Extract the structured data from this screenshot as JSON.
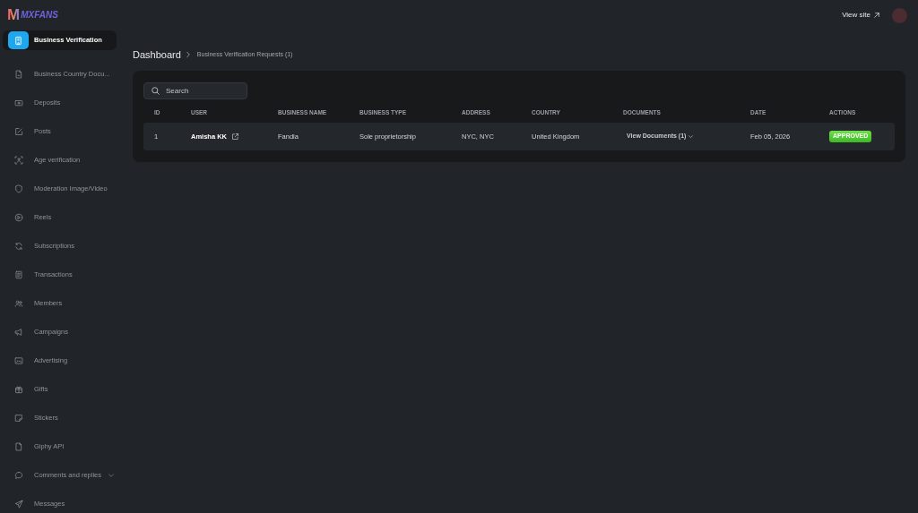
{
  "logo": {
    "mark": "M",
    "name": "MXFANS"
  },
  "sidebar": {
    "items": [
      {
        "label": "Business Verification",
        "kind": "link",
        "selected": true
      },
      {
        "label": "Business Country Docu...",
        "kind": "link",
        "selected": false
      },
      {
        "label": "Deposits",
        "kind": "link",
        "selected": false
      },
      {
        "label": "Posts",
        "kind": "link",
        "selected": false
      },
      {
        "label": "Age verification",
        "kind": "link",
        "selected": false
      },
      {
        "label": "Moderation Image/Video",
        "kind": "link",
        "selected": false
      },
      {
        "label": "Reels",
        "kind": "link",
        "selected": false
      },
      {
        "label": "Subscriptions",
        "kind": "link",
        "selected": false
      },
      {
        "label": "Transactions",
        "kind": "link",
        "selected": false
      },
      {
        "label": "Members",
        "kind": "link",
        "selected": false
      },
      {
        "label": "Campaigns",
        "kind": "link",
        "selected": false
      },
      {
        "label": "Advertising",
        "kind": "link",
        "selected": false
      },
      {
        "label": "Gifts",
        "kind": "link",
        "selected": false
      },
      {
        "label": "Stickers",
        "kind": "link",
        "selected": false
      },
      {
        "label": "Giphy API",
        "kind": "link",
        "selected": false
      },
      {
        "label": "Comments and replies",
        "kind": "group",
        "selected": false
      },
      {
        "label": "Messages",
        "kind": "link",
        "selected": false
      }
    ]
  },
  "top_bar": {
    "view_site": "View site"
  },
  "breadcrumb": [
    "Dashboard",
    "Business Verification Requests (1)"
  ],
  "search": {
    "placeholder": "Search"
  },
  "table": {
    "columns": [
      "ID",
      "USER",
      "BUSINESS NAME",
      "BUSINESS TYPE",
      "ADDRESS",
      "COUNTRY",
      "DOCUMENTS",
      "DATE",
      "ACTIONS"
    ],
    "rows": [
      {
        "id": "1",
        "user": "Amisha KK",
        "business_name": "Fandia",
        "business_type": "Sole proprietorship",
        "address": "NYC, NYC",
        "country": "United Kingdom",
        "documents": "View Documents (1)",
        "date": "Feb 05, 2026",
        "status": "APPROVED"
      }
    ]
  }
}
